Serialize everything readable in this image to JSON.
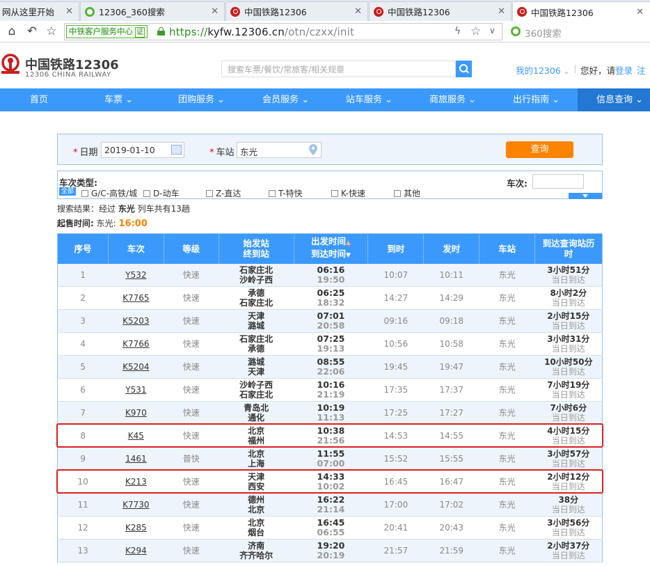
{
  "browser": {
    "tabs": [
      {
        "title": "网从这里开始",
        "icon": "none"
      },
      {
        "title": "12306_360搜索",
        "icon": "360-search-favicon"
      },
      {
        "title": "中国铁路12306",
        "icon": "railway-favicon"
      },
      {
        "title": "中国铁路12306",
        "icon": "railway-favicon"
      },
      {
        "title": "中国铁路12306",
        "icon": "railway-favicon"
      }
    ],
    "security_badge": "中铁客户服务中心",
    "security_verified": "证",
    "url_scheme": "https://",
    "url_host": "kyfw.12306.cn",
    "url_path": "/otn/czxx/init",
    "search_placeholder": "360搜索"
  },
  "site": {
    "logo_title": "中国铁路12306",
    "logo_subtitle": "12306 CHINA RAILWAY",
    "search_placeholder": "搜索车票/餐饮/常旅客/相关规章",
    "my_account": "我的12306",
    "greeting": "您好，请",
    "login": "登录",
    "register": "注"
  },
  "nav": [
    {
      "label": "首页",
      "dropdown": false
    },
    {
      "label": "车票",
      "dropdown": true
    },
    {
      "label": "团购服务",
      "dropdown": true
    },
    {
      "label": "会员服务",
      "dropdown": true
    },
    {
      "label": "站车服务",
      "dropdown": true
    },
    {
      "label": "商旅服务",
      "dropdown": true
    },
    {
      "label": "出行指南",
      "dropdown": true
    },
    {
      "label": "信息查询",
      "dropdown": true,
      "active": true
    }
  ],
  "form": {
    "date_label": "日期",
    "date_value": "2019-01-10",
    "station_label": "车站",
    "station_value": "东光",
    "query_button": "查询",
    "required_mark": "*"
  },
  "filter": {
    "title": "车次类型:",
    "all": "全部",
    "options": [
      "G/C-高铁/城",
      "D-动车",
      "Z-直达",
      "T-特快",
      "K-快速",
      "其他"
    ],
    "train_no_label": "车次:"
  },
  "result": {
    "prefix": "搜索结果：经过 ",
    "station": "东光",
    "suffix": " 列车共有13趟",
    "sale_label": "起售时间:",
    "sale_station": " 东光: ",
    "sale_time": "16:00"
  },
  "table": {
    "headers": {
      "seq": "序号",
      "train": "车次",
      "grade": "等级",
      "from_to_1": "始发站",
      "from_to_2": "终到站",
      "time_1": "出发时间",
      "time_2": "到达时间",
      "arrive": "到时",
      "depart": "发时",
      "station": "车站",
      "duration_1": "到达查询站历",
      "duration_2": "时"
    },
    "rows": [
      {
        "seq": "1",
        "train": "Y532",
        "grade": "快速",
        "from": "石家庄北",
        "to": "沙岭子西",
        "dep": "06:16",
        "arr": "19:50",
        "arrive": "10:07",
        "depart": "10:11",
        "station": "东光",
        "duration": "3小时51分",
        "day": "当日到达"
      },
      {
        "seq": "2",
        "train": "K7765",
        "grade": "快速",
        "from": "承德",
        "to": "石家庄北",
        "dep": "06:25",
        "arr": "18:32",
        "arrive": "14:27",
        "depart": "14:29",
        "station": "东光",
        "duration": "8小时2分",
        "day": "当日到达"
      },
      {
        "seq": "3",
        "train": "K5203",
        "grade": "快速",
        "from": "天津",
        "to": "潞城",
        "dep": "07:01",
        "arr": "20:58",
        "arrive": "09:16",
        "depart": "09:18",
        "station": "东光",
        "duration": "2小时15分",
        "day": "当日到达"
      },
      {
        "seq": "4",
        "train": "K7766",
        "grade": "快速",
        "from": "石家庄北",
        "to": "承德",
        "dep": "07:25",
        "arr": "19:13",
        "arrive": "10:56",
        "depart": "10:58",
        "station": "东光",
        "duration": "3小时31分",
        "day": "当日到达"
      },
      {
        "seq": "5",
        "train": "K5204",
        "grade": "快速",
        "from": "潞城",
        "to": "天津",
        "dep": "08:55",
        "arr": "22:06",
        "arrive": "19:45",
        "depart": "19:47",
        "station": "东光",
        "duration": "10小时50分",
        "day": "当日到达"
      },
      {
        "seq": "6",
        "train": "Y531",
        "grade": "快速",
        "from": "沙岭子西",
        "to": "石家庄北",
        "dep": "10:16",
        "arr": "21:19",
        "arrive": "17:35",
        "depart": "17:37",
        "station": "东光",
        "duration": "7小时19分",
        "day": "当日到达"
      },
      {
        "seq": "7",
        "train": "K970",
        "grade": "快速",
        "from": "青岛北",
        "to": "通化",
        "dep": "10:19",
        "arr": "11:13",
        "arrive": "17:25",
        "depart": "17:27",
        "station": "东光",
        "duration": "7小时6分",
        "day": "当日到达"
      },
      {
        "seq": "8",
        "train": "K45",
        "grade": "快速",
        "from": "北京",
        "to": "福州",
        "dep": "10:38",
        "arr": "21:56",
        "arrive": "14:53",
        "depart": "14:55",
        "station": "东光",
        "duration": "4小时15分",
        "day": "当日到达"
      },
      {
        "seq": "9",
        "train": "1461",
        "grade": "普快",
        "from": "北京",
        "to": "上海",
        "dep": "11:55",
        "arr": "07:00",
        "arrive": "15:52",
        "depart": "15:55",
        "station": "东光",
        "duration": "3小时57分",
        "day": "当日到达"
      },
      {
        "seq": "10",
        "train": "K213",
        "grade": "快速",
        "from": "天津",
        "to": "西安",
        "dep": "14:33",
        "arr": "10:02",
        "arrive": "16:45",
        "depart": "16:47",
        "station": "东光",
        "duration": "2小时12分",
        "day": "当日到达"
      },
      {
        "seq": "11",
        "train": "K7730",
        "grade": "快速",
        "from": "德州",
        "to": "北京",
        "dep": "16:22",
        "arr": "21:14",
        "arrive": "17:00",
        "depart": "17:02",
        "station": "东光",
        "duration": "38分",
        "day": "当日到达"
      },
      {
        "seq": "12",
        "train": "K285",
        "grade": "快速",
        "from": "北京",
        "to": "烟台",
        "dep": "16:45",
        "arr": "06:55",
        "arrive": "20:41",
        "depart": "20:43",
        "station": "东光",
        "duration": "3小时56分",
        "day": "当日到达"
      },
      {
        "seq": "13",
        "train": "K294",
        "grade": "快速",
        "from": "济南",
        "to": "齐齐哈尔",
        "dep": "19:20",
        "arr": "20:19",
        "arrive": "21:57",
        "depart": "21:59",
        "station": "东光",
        "duration": "2小时37分",
        "day": "当日到达"
      }
    ],
    "highlighted_rows": [
      "8",
      "10"
    ]
  },
  "colors": {
    "brand_blue": "#3b99fc",
    "nav_active": "#2278d3",
    "query_orange": "#fc8302",
    "highlight_red": "#e01e1e",
    "logo_red": "#c81e1e"
  }
}
